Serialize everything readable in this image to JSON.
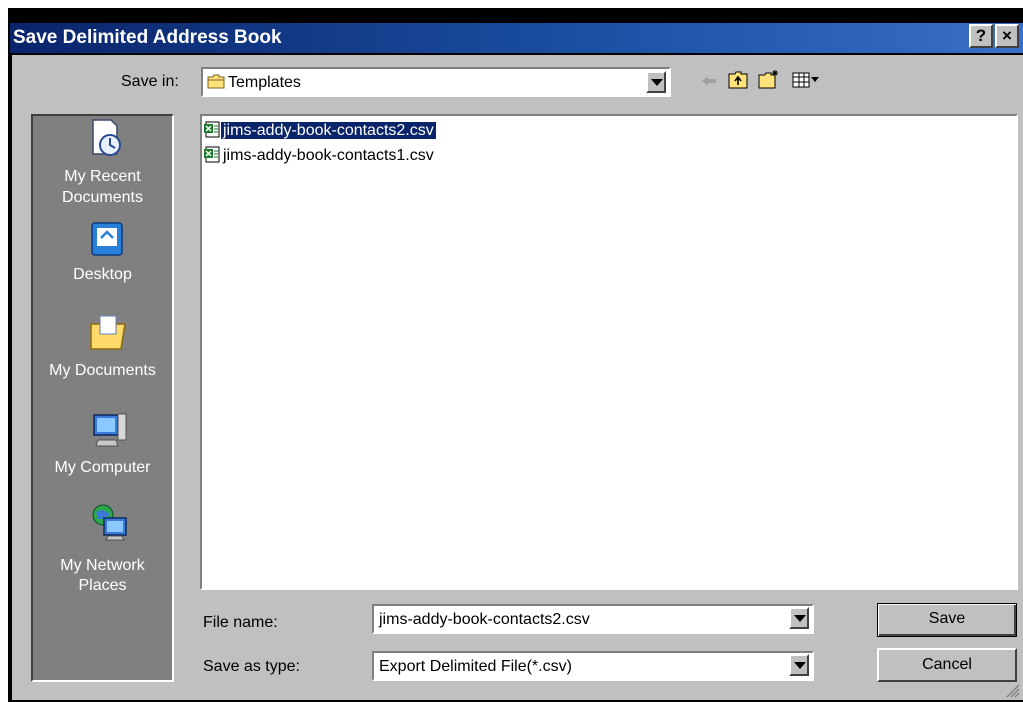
{
  "dialog": {
    "title": "Save Delimited Address Book",
    "help_button": "?",
    "close_button": "×"
  },
  "save_in": {
    "label": "Save in:",
    "value": "Templates"
  },
  "places": [
    {
      "label_line1": "My Recent",
      "label_line2": "Documents",
      "icon": "recent-documents-icon"
    },
    {
      "label_line1": "Desktop",
      "label_line2": "",
      "icon": "desktop-icon"
    },
    {
      "label_line1": "My Documents",
      "label_line2": "",
      "icon": "my-documents-icon"
    },
    {
      "label_line1": "My Computer",
      "label_line2": "",
      "icon": "my-computer-icon"
    },
    {
      "label_line1": "My Network",
      "label_line2": "Places",
      "icon": "network-places-icon"
    }
  ],
  "files": [
    {
      "name": "jims-addy-book-contacts2.csv",
      "selected": true
    },
    {
      "name": "jims-addy-book-contacts1.csv",
      "selected": false
    }
  ],
  "file_name": {
    "label": "File name:",
    "value": "jims-addy-book-contacts2.csv"
  },
  "save_as_type": {
    "label": "Save as type:",
    "value": "Export Delimited File(*.csv)"
  },
  "buttons": {
    "save": "Save",
    "cancel": "Cancel"
  },
  "colors": {
    "title_gradient_start": "#0a246a",
    "title_gradient_end": "#3a6ec8",
    "dialog_face": "#c0c0c0",
    "places_bar": "#808080",
    "selection": "#0a246a"
  }
}
